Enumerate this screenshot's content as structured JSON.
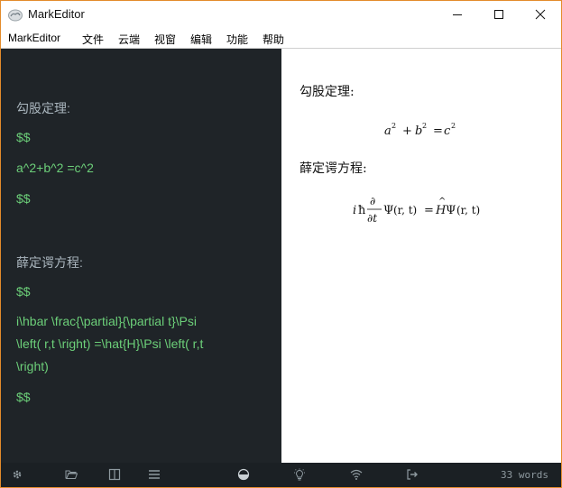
{
  "window": {
    "title": "MarkEditor",
    "buttons": [
      "minimize",
      "maximize",
      "close"
    ]
  },
  "menu": {
    "items": [
      "MarkEditor",
      "文件",
      "云端",
      "视窗",
      "编辑",
      "功能",
      "帮助"
    ]
  },
  "editor": {
    "lines": [
      {
        "text": "勾股定理:",
        "kind": "heading"
      },
      {
        "text": "$$",
        "kind": "math"
      },
      {
        "text": "a^2+b^2 =c^2",
        "kind": "math"
      },
      {
        "text": "$$",
        "kind": "math"
      },
      {
        "text": "薛定谔方程:",
        "kind": "heading"
      },
      {
        "text": "$$",
        "kind": "math"
      },
      {
        "text": "i\\hbar \\frac{\\partial}{\\partial t}\\Psi",
        "kind": "math"
      },
      {
        "text": "\\left( r,t \\right) =\\hat{H}\\Psi \\left( r,t",
        "kind": "math"
      },
      {
        "text": "\\right)",
        "kind": "math"
      },
      {
        "text": "$$",
        "kind": "math"
      }
    ]
  },
  "preview": {
    "heading1": "勾股定理:",
    "heading2": "薛定谔方程:",
    "formula1": {
      "a": "a",
      "plus": "+",
      "b": "b",
      "eq": "=",
      "c": "c",
      "exp": "2"
    },
    "formula2": {
      "i": "i",
      "hbar": "ħ",
      "partial_num": "∂",
      "partial_den": "∂t",
      "psi": "Ψ",
      "args": "(r, t)",
      "eq": "=",
      "hat": "^",
      "H": "H"
    }
  },
  "statusbar": {
    "icons": [
      "gear-icon",
      "folder-open-icon",
      "split-view-icon",
      "list-icon",
      "theme-toggle-icon",
      "bulb-icon",
      "wifi-icon",
      "export-icon"
    ],
    "word_count": "33 words"
  },
  "colors": {
    "editor_bg": "#1f2428",
    "editor_heading": "#a9b5bd",
    "editor_math": "#6ccf79",
    "statusbar_bg": "#1b2024",
    "window_border": "#e38b2b"
  }
}
